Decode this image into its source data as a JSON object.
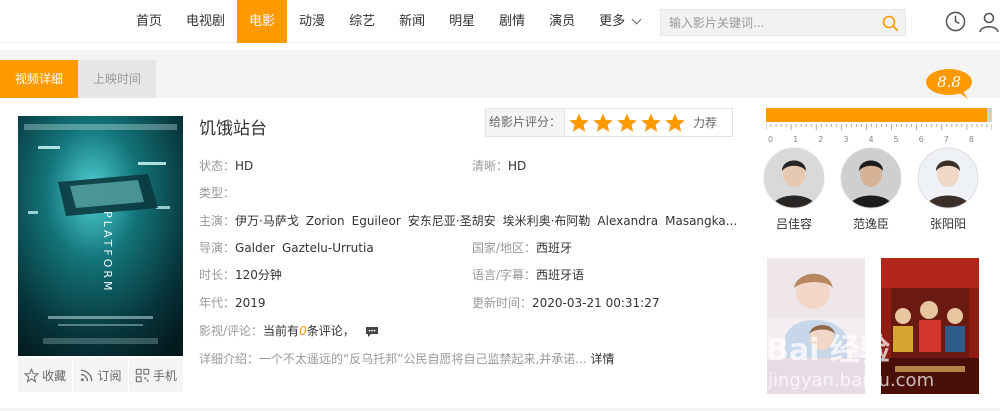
{
  "nav": {
    "items": [
      "首页",
      "电视剧",
      "电影",
      "动漫",
      "综艺",
      "新闻",
      "明星",
      "剧情",
      "演员"
    ],
    "active_index": 2,
    "more_label": "更多"
  },
  "search": {
    "placeholder": "输入影片关键词..."
  },
  "tabs": [
    "视频详细",
    "上映时间"
  ],
  "movie": {
    "title": "饥饿站台",
    "status_label": "状态：",
    "status": "HD",
    "clarity_label": "清晰：",
    "clarity": "HD",
    "type_label": "类型：",
    "cast_label": "主演：",
    "cast": [
      "伊万·马萨戈",
      "Zorion",
      "Eguileor",
      "安东尼亚·圣胡安",
      "埃米利奥·布阿勒",
      "Alexandra",
      "Masangka..."
    ],
    "director_label": "导演：",
    "directors": [
      "Galder",
      "Gaztelu-Urrutia"
    ],
    "region_label": "国家/地区：",
    "region": "西班牙",
    "duration_label": "时长：",
    "duration": "120分钟",
    "language_label": "语言/字幕：",
    "language": "西班牙语",
    "year_label": "年代：",
    "year": "2019",
    "updated_label": "更新时间：",
    "updated": "2020-03-21 00:31:27",
    "comment_label": "影视/评论：",
    "comment_prefix": "当前有",
    "comment_count": "0",
    "comment_suffix": "条评论，",
    "desc_label": "详细介绍：",
    "description": "一个不太遥远的“反乌托邦”公民自愿将自己监禁起来,并承诺...",
    "desc_more": "详情"
  },
  "poster": {
    "tagline": "PLATFORM"
  },
  "poster_actions": [
    "收藏",
    "订阅",
    "手机"
  ],
  "rating": {
    "label": "给影片评分：",
    "stars": 5,
    "text": "力荐",
    "score": "8.8",
    "scale_max": 9,
    "ruler_labels": [
      "0",
      "1",
      "2",
      "3",
      "4",
      "5",
      "6",
      "7",
      "8"
    ]
  },
  "actors": [
    "吕佳容",
    "范逸臣",
    "张阳阳"
  ],
  "watermark": {
    "main": "Bai 经验",
    "sub": "jingyan.baidu.com"
  },
  "colors": {
    "accent": "#ff9900",
    "muted": "#999999"
  }
}
